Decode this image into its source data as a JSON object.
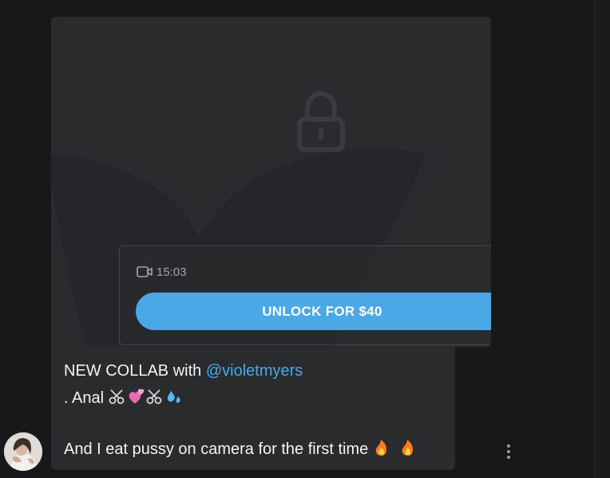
{
  "message": {
    "media": {
      "duration": "15:03",
      "unlock_label": "UNLOCK FOR $40"
    },
    "text": {
      "prefix": "NEW COLLAB with ",
      "mention": "@violetmyers",
      "line2_text": ". Anal ",
      "line3_text": "And I eat pussy on camera for the first time "
    }
  },
  "icons": {
    "lock": "lock-icon",
    "video": "video-camera-icon",
    "avatar": "avatar",
    "more": "more-vertical-icon"
  },
  "colors": {
    "background": "#18181a",
    "card": "#2a2b2e",
    "accent": "#4aa8e6",
    "text": "#f4f4f5",
    "muted": "#a3a5aa"
  }
}
